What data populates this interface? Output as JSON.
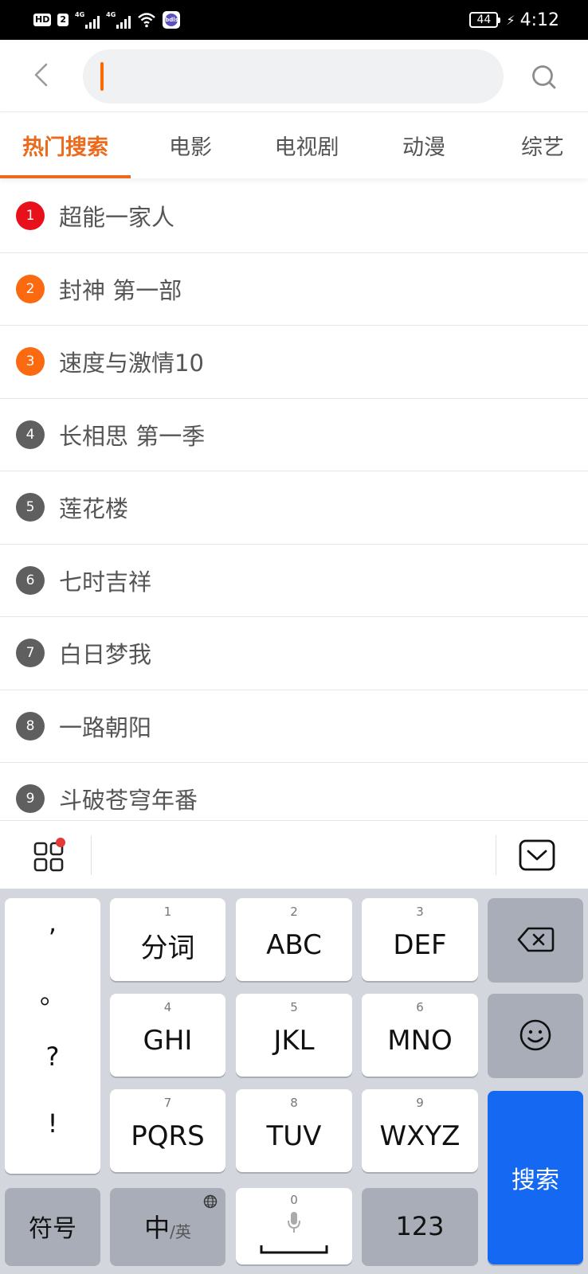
{
  "status_bar": {
    "hd_label": "HD",
    "sim_label": "2",
    "net1_label": "4G",
    "net2_label": "4G",
    "app_badge_label": "bdls",
    "battery_level": "44",
    "time": "4:12"
  },
  "search": {
    "placeholder": "",
    "value": "",
    "caret_color": "#ff6a00"
  },
  "tabs": [
    {
      "label": "热门搜索",
      "active": true
    },
    {
      "label": "电影",
      "active": false
    },
    {
      "label": "电视剧",
      "active": false
    },
    {
      "label": "动漫",
      "active": false
    },
    {
      "label": "综艺",
      "active": false
    }
  ],
  "accent_color": "#ec6a1c",
  "hot_list": [
    {
      "rank": "1",
      "title": "超能一家人",
      "badge_color": "#e8101a"
    },
    {
      "rank": "2",
      "title": "封神 第一部",
      "badge_color": "#fb6a11"
    },
    {
      "rank": "3",
      "title": "速度与激情10",
      "badge_color": "#fb6a11"
    },
    {
      "rank": "4",
      "title": "长相思 第一季",
      "badge_color": "#5f5f5f"
    },
    {
      "rank": "5",
      "title": "莲花楼",
      "badge_color": "#5f5f5f"
    },
    {
      "rank": "6",
      "title": "七时吉祥",
      "badge_color": "#5f5f5f"
    },
    {
      "rank": "7",
      "title": "白日梦我",
      "badge_color": "#5f5f5f"
    },
    {
      "rank": "8",
      "title": "一路朝阳",
      "badge_color": "#5f5f5f"
    },
    {
      "rank": "9",
      "title": "斗破苍穹年番",
      "badge_color": "#5f5f5f"
    }
  ],
  "keyboard": {
    "punctuation": [
      ",",
      "。",
      "?",
      "!"
    ],
    "keys": [
      {
        "num": "1",
        "label": "分词"
      },
      {
        "num": "2",
        "label": "ABC"
      },
      {
        "num": "3",
        "label": "DEF"
      },
      {
        "num": "4",
        "label": "GHI"
      },
      {
        "num": "5",
        "label": "JKL"
      },
      {
        "num": "6",
        "label": "MNO"
      },
      {
        "num": "7",
        "label": "PQRS"
      },
      {
        "num": "8",
        "label": "TUV"
      },
      {
        "num": "9",
        "label": "WXYZ"
      }
    ],
    "symbols_label": "符号",
    "lang_main": "中",
    "lang_alt": "/英",
    "space_num": "0",
    "numbers_label": "123",
    "search_label": "搜索",
    "search_key_color": "#1468f2"
  }
}
